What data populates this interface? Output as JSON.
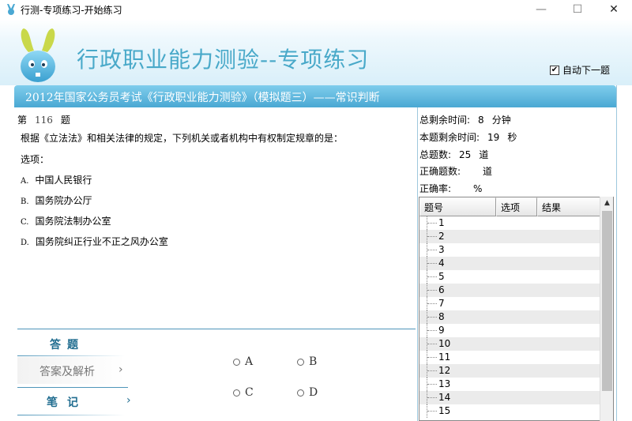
{
  "window": {
    "title": "行测-专项练习-开始练习",
    "minimize": "—",
    "maximize": "☐",
    "close": "✕"
  },
  "header": {
    "app_title": "行政职业能力测验--专项练习",
    "auto_next_label": "自动下一题",
    "auto_next_checked": "✔"
  },
  "banner": {
    "text": "2012年国家公务员考试《行政职业能力测验》（模拟题三）——常识判断"
  },
  "question": {
    "prefix": "第",
    "number": "116",
    "suffix": "题",
    "text": "根据《立法法》和相关法律的规定，下列机关或者机构中有权制定规章的是：",
    "options_label": "选项：",
    "choices": [
      {
        "key": "A.",
        "text": "中国人民银行"
      },
      {
        "key": "B.",
        "text": "国务院办公厅"
      },
      {
        "key": "C.",
        "text": "国务院法制办公室"
      },
      {
        "key": "D.",
        "text": "国务院纠正行业不正之风办公室"
      }
    ]
  },
  "tabs": {
    "answer": "答题",
    "analysis": "答案及解析",
    "analysis_chevron": "›",
    "notes": "笔记",
    "notes_chevron": "›"
  },
  "answer_options": [
    "A",
    "B",
    "C",
    "D"
  ],
  "stats": {
    "total_time_label": "总剩余时间:",
    "total_time_value": "8",
    "total_time_unit": "分钟",
    "q_time_label": "本题剩余时间:",
    "q_time_value": "19",
    "q_time_unit": "秒",
    "total_q_label": "总题数:",
    "total_q_value": "25",
    "total_q_unit": "道",
    "correct_label": "正确题数:",
    "correct_value": "",
    "correct_unit": "道",
    "rate_label": "正确率:",
    "rate_value": "",
    "rate_unit": "%"
  },
  "grid": {
    "columns": [
      "题号",
      "选项",
      "结果"
    ],
    "rows": [
      "1",
      "2",
      "3",
      "4",
      "5",
      "6",
      "7",
      "8",
      "9",
      "10",
      "11",
      "12",
      "13",
      "14",
      "15"
    ]
  },
  "scrollbar": {
    "up_arrow": "▲"
  }
}
